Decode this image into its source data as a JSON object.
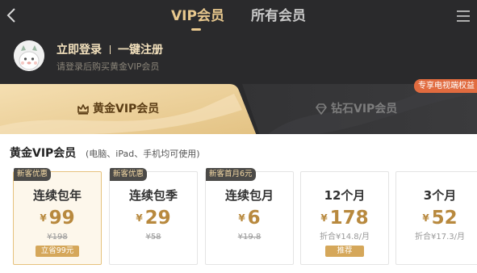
{
  "nav": {
    "tabs": [
      {
        "label": "VIP会员",
        "active": true
      },
      {
        "label": "所有会员",
        "active": false
      }
    ],
    "back_icon": "chevron-left-icon",
    "menu_icon": "hamburger-menu-icon"
  },
  "user": {
    "login_label": "立即登录",
    "register_label": "一键注册",
    "hint": "请登录后购买黄金VIP会员"
  },
  "tiers": {
    "gold": {
      "label": "黄金VIP会员",
      "icon": "crown-icon"
    },
    "diamond": {
      "label": "钻石VIP会员",
      "icon": "diamond-icon",
      "badge": "专享电视端权益"
    }
  },
  "section": {
    "title": "黄金VIP会员",
    "subtitle": "(电脑、iPad、手机均可使用)"
  },
  "plans": [
    {
      "badge": "新客优惠",
      "name": "连续包年",
      "currency": "¥",
      "price": "99",
      "original": "¥198",
      "tag": "立省99元",
      "selected": true
    },
    {
      "badge": "新客优惠",
      "name": "连续包季",
      "currency": "¥",
      "price": "29",
      "original": "¥58",
      "selected": false
    },
    {
      "badge": "新客首月6元",
      "name": "连续包月",
      "currency": "¥",
      "price": "6",
      "original": "¥19.8",
      "selected": false
    },
    {
      "name": "12个月",
      "currency": "¥",
      "price": "178",
      "monthly": "折合¥14.8/月",
      "tag": "推荐",
      "selected": false
    },
    {
      "name": "3个月",
      "currency": "¥",
      "price": "52",
      "monthly": "折合¥17.3/月",
      "selected": false
    }
  ],
  "colors": {
    "header_bg": "#2a2a2c",
    "gold_accent": "#e8c88e",
    "price": "#b8893e",
    "badge_bg": "#4b4a48",
    "tv_badge": "#e16b3f"
  }
}
